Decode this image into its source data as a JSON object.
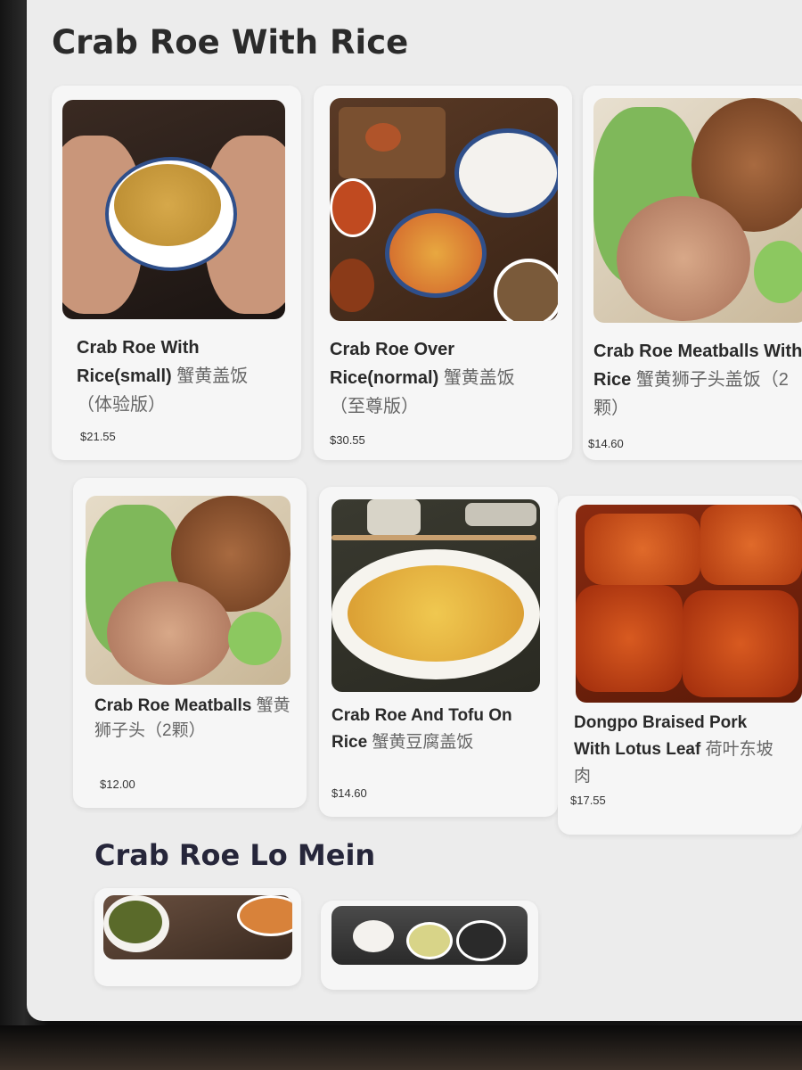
{
  "sections": [
    {
      "title": "Crab Roe With Rice",
      "items": [
        {
          "name": "Crab Roe With Rice(small)",
          "name_zh": "蟹黄盖饭（体验版）",
          "price": "$21.55"
        },
        {
          "name": "Crab Roe Over Rice(normal)",
          "name_zh": "蟹黄盖饭（至尊版）",
          "price": "$30.55"
        },
        {
          "name": "Crab Roe Meatballs With Rice",
          "name_zh": "蟹黄狮子头盖饭（2颗）",
          "price": "$14.60"
        },
        {
          "name": "Crab Roe Meatballs",
          "name_zh": "蟹黄狮子头（2颗）",
          "price": "$12.00"
        },
        {
          "name": "Crab Roe And Tofu On Rice",
          "name_zh": "蟹黄豆腐盖饭",
          "price": "$14.60"
        },
        {
          "name": "Dongpo Braised Pork With Lotus Leaf",
          "name_zh": "荷叶东坡肉",
          "price": "$17.55"
        }
      ]
    },
    {
      "title": "Crab Roe Lo Mein",
      "items": []
    }
  ]
}
